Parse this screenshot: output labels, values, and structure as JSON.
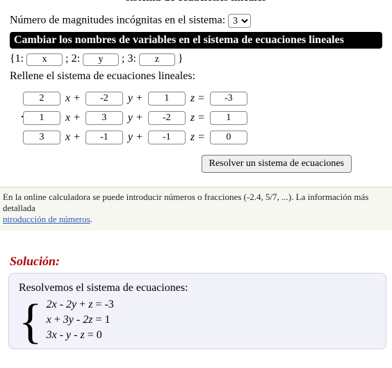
{
  "header_cut": "sistema de ecuaciones lineales",
  "unknowns": {
    "label": "Número de magnitudes incógnitas en el sistema:",
    "value": "3"
  },
  "rename_band": "Cambiar los nombres de variables en el sistema de ecuaciones lineales",
  "vars": {
    "open": "{1:",
    "sep2": "; 2:",
    "sep3": "; 3:",
    "close": "}",
    "v1": "x",
    "v2": "y",
    "v3": "z"
  },
  "fill_label": "Rellene el sistema de ecuaciones lineales:",
  "eq": {
    "rows": [
      {
        "a": "2",
        "b": "-2",
        "c": "1",
        "r": "-3"
      },
      {
        "a": "1",
        "b": "3",
        "c": "-2",
        "r": "1"
      },
      {
        "a": "3",
        "b": "-1",
        "c": "-1",
        "r": "0"
      }
    ],
    "xplus": "x +",
    "yplus": "y +",
    "zeq": "z ="
  },
  "solve_button": "Resolver un sistema de ecuaciones",
  "footnote": {
    "pre": "En la online calculadora se puede introducir números o fracciones (-2.4, 5/7, ...). La información más detallada",
    "link": "ntroducción de números",
    "post": "."
  },
  "solution": {
    "title": "Solución:",
    "lead": "Resolvemos el sistema de ecuaciones:",
    "lines": [
      "2x - 2y + z = -3",
      "x + 3y - 2z = 1",
      "3x - y - z = 0"
    ]
  }
}
